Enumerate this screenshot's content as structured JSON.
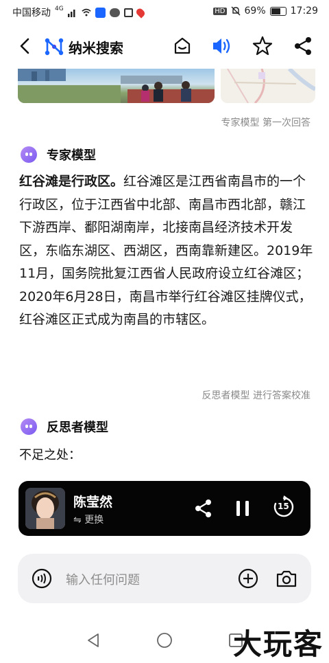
{
  "status_bar": {
    "carrier": "中国移动",
    "network": "4G",
    "battery": "69%",
    "time": "17:29"
  },
  "header": {
    "title": "纳米搜索"
  },
  "expert_section": {
    "meta": "专家模型  第一次回答",
    "model_name": "专家模型",
    "answer_bold": "红谷滩是行政区。",
    "answer_body": "红谷滩区是江西省南昌市的一个行政区，位于江西省中北部、南昌市西北部，赣江下游西岸、鄱阳湖南岸，北接南昌经济技术开发区，东临东湖区、西湖区，西南靠新建区。2019年11月，国务院批复江西省人民政府设立红谷滩区；2020年6月28日，南昌市举行红谷滩区挂牌仪式，红谷滩区正式成为南昌的市辖区。"
  },
  "reflect_section": {
    "meta": "反思者模型  进行答案校准",
    "model_name": "反思者模型",
    "text": "不足之处："
  },
  "player": {
    "speaker": "陈莹然",
    "swap_label": "更换",
    "skip_seconds": "15"
  },
  "input": {
    "placeholder": "输入任何问题"
  },
  "watermark": "大玩客",
  "colors": {
    "accent_blue": "#1a66ff",
    "model_purple": "#8a63f2"
  }
}
